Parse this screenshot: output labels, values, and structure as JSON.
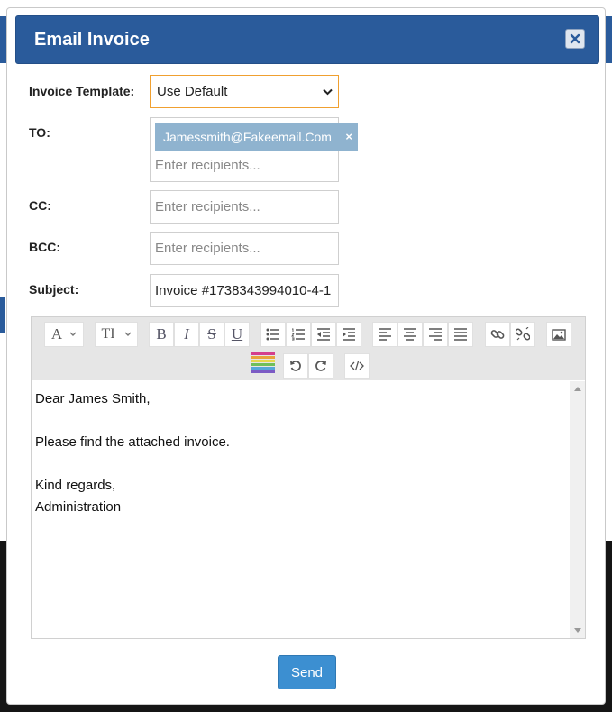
{
  "modal": {
    "title": "Email Invoice",
    "header_color": "#2a5b9b"
  },
  "form": {
    "template_label": "Invoice Template:",
    "template_value": "Use Default",
    "to_label": "TO:",
    "to_tag": "Jamessmith@Fakeemail.Com",
    "to_placeholder": "Enter recipients...",
    "cc_label": "CC:",
    "cc_placeholder": "Enter recipients...",
    "bcc_label": "BCC:",
    "bcc_placeholder": "Enter recipients...",
    "subject_label": "Subject:",
    "subject_value": "Invoice #1738343994010-4-1"
  },
  "toolbar": {
    "icons": [
      "font-color-icon",
      "font-size-icon",
      "bold-icon",
      "italic-icon",
      "strikethrough-icon",
      "underline-icon",
      "bullet-list-icon",
      "numbered-list-icon",
      "outdent-icon",
      "indent-icon",
      "align-left-icon",
      "align-center-icon",
      "align-right-icon",
      "justify-icon",
      "link-icon",
      "unlink-icon",
      "image-icon",
      "color-palette-icon",
      "undo-icon",
      "redo-icon",
      "code-view-icon"
    ],
    "font_color_glyph": "A",
    "font_size_glyph": "TI",
    "bold_glyph": "B",
    "italic_glyph": "I",
    "strike_glyph": "S",
    "underline_glyph": "U"
  },
  "editor": {
    "lines": [
      "Dear James Smith,",
      "",
      "Please find the attached invoice.",
      "",
      "Kind regards,",
      "Administration"
    ]
  },
  "actions": {
    "send_label": "Send",
    "send_color": "#3c8fd1"
  }
}
